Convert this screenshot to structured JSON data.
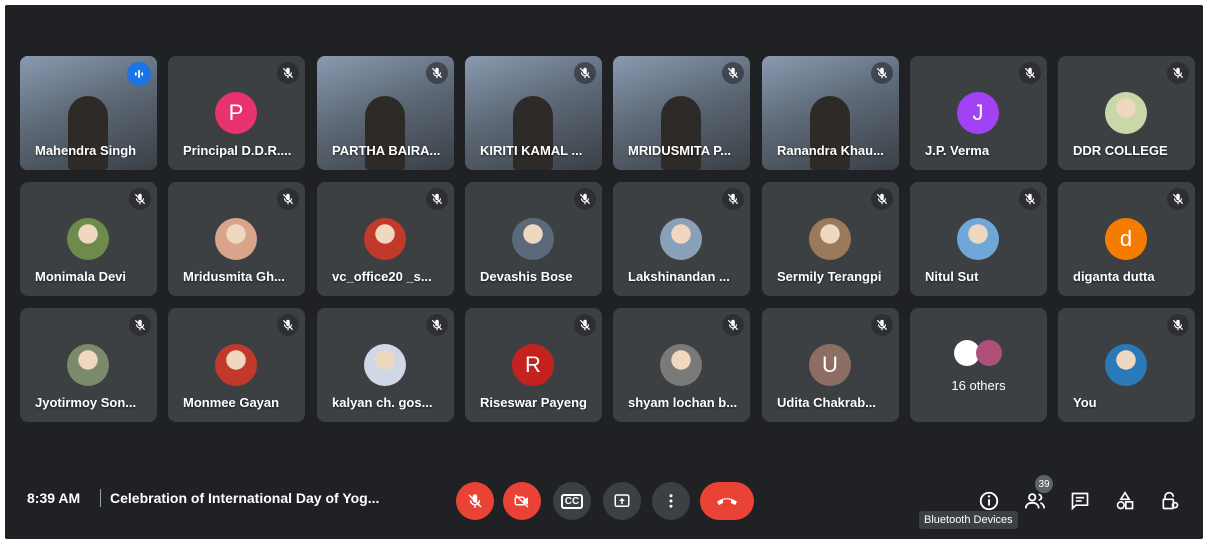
{
  "participants": [
    {
      "name": "Mahendra Singh",
      "kind": "video",
      "speaking": true
    },
    {
      "name": "Principal D.D.R....",
      "kind": "letter",
      "letter": "P",
      "color": "#e8336e"
    },
    {
      "name": "PARTHA BAIRA...",
      "kind": "video"
    },
    {
      "name": "KIRITI KAMAL ...",
      "kind": "video"
    },
    {
      "name": "MRIDUSMITA P...",
      "kind": "video"
    },
    {
      "name": "Ranandra Khau...",
      "kind": "video"
    },
    {
      "name": "J.P. Verma",
      "kind": "letter",
      "letter": "J",
      "color": "#a142f4"
    },
    {
      "name": "DDR COLLEGE",
      "kind": "photo",
      "photo_color": "#c8d8a8"
    },
    {
      "name": "Monimala Devi",
      "kind": "photo",
      "photo_color": "#6d8b4a"
    },
    {
      "name": "Mridusmita Gh...",
      "kind": "photo",
      "photo_color": "#d9a58a"
    },
    {
      "name": "vc_office20 _s...",
      "kind": "photo",
      "photo_color": "#c0392b"
    },
    {
      "name": "Devashis Bose",
      "kind": "photo",
      "photo_color": "#5a6a7a"
    },
    {
      "name": "Lakshinandan ...",
      "kind": "photo",
      "photo_color": "#8aa0b8"
    },
    {
      "name": "Sermily Terangpi",
      "kind": "photo",
      "photo_color": "#9a7a5a"
    },
    {
      "name": "Nitul Sut",
      "kind": "photo",
      "photo_color": "#6fa8d8"
    },
    {
      "name": "diganta dutta",
      "kind": "letter",
      "letter": "d",
      "color": "#f57c00"
    },
    {
      "name": "Jyotirmoy Son...",
      "kind": "photo",
      "photo_color": "#7a8a6a"
    },
    {
      "name": "Monmee Gayan",
      "kind": "photo",
      "photo_color": "#c0392b"
    },
    {
      "name": "kalyan ch. gos...",
      "kind": "photo",
      "photo_color": "#d0d8e8"
    },
    {
      "name": "Riseswar Payeng",
      "kind": "letter",
      "letter": "R",
      "color": "#c5221f"
    },
    {
      "name": "shyam lochan b...",
      "kind": "photo",
      "photo_color": "#7a7a7a"
    },
    {
      "name": "Udita Chakrab...",
      "kind": "letter",
      "letter": "U",
      "color": "#8d6e63"
    },
    {
      "name": "",
      "kind": "others",
      "label": "16 others"
    },
    {
      "name": "You",
      "kind": "photo",
      "photo_color": "#2a7ab8",
      "unmuted": true
    }
  ],
  "meeting": {
    "time": "8:39 AM",
    "title": "Celebration of International Day of Yog..."
  },
  "controls": {
    "captions_label": "CC",
    "participants_count": "39",
    "tooltip": "Bluetooth Devices"
  },
  "colors": {
    "background": "#202124",
    "tile": "#3c4043",
    "danger": "#ea4335",
    "accent": "#1a73e8"
  }
}
